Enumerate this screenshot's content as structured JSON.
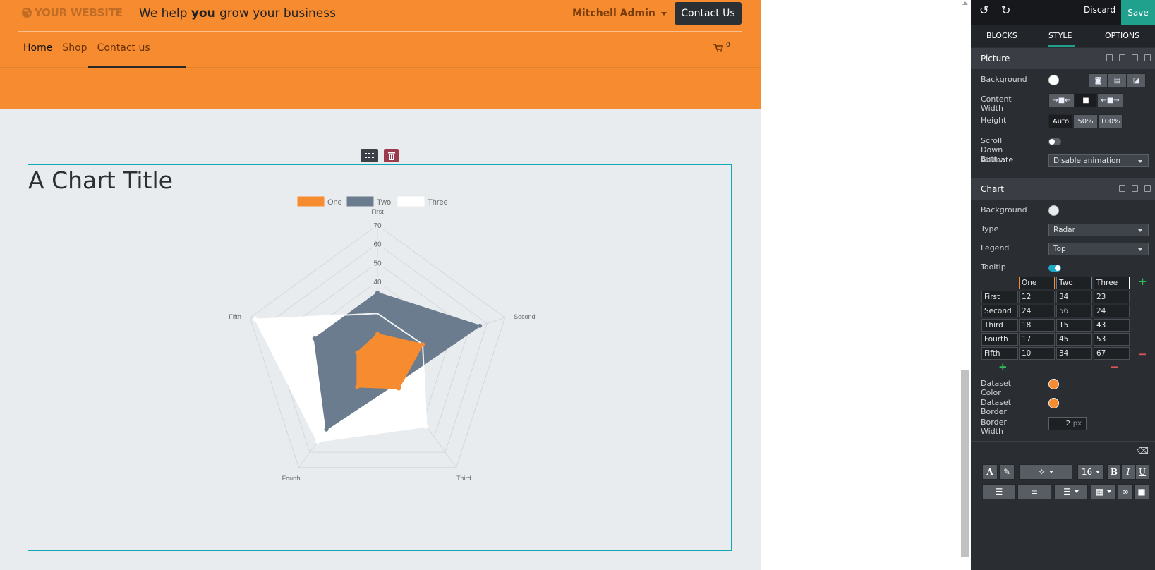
{
  "header": {
    "logo_text": "YOUR WEBSITE",
    "tagline_pre": "We help ",
    "tagline_bold": "you",
    "tagline_post": " grow your business",
    "user_name": "Mitchell Admin",
    "contact_label": "Contact Us",
    "cart_count": "0",
    "nav": [
      {
        "label": "Home",
        "active": true
      },
      {
        "label": "Shop",
        "active": false
      },
      {
        "label": "Contact us",
        "active": false
      }
    ]
  },
  "colors": {
    "brand_orange": "#f78b2f",
    "series_one": "#f78b2f",
    "series_two": "#6b7c8f",
    "series_three": "#ffffff",
    "accent_teal": "#1fa18e"
  },
  "chart_data": {
    "type": "radar",
    "title": "A Chart Title",
    "categories": [
      "First",
      "Second",
      "Third",
      "Fourth",
      "Fifth"
    ],
    "series": [
      {
        "name": "One",
        "values": [
          12,
          24,
          18,
          17,
          10
        ]
      },
      {
        "name": "Two",
        "values": [
          34,
          56,
          15,
          45,
          34
        ]
      },
      {
        "name": "Three",
        "values": [
          23,
          24,
          43,
          53,
          67
        ]
      }
    ],
    "r_ticks": [
      40,
      50,
      60,
      70
    ],
    "rlim": [
      10,
      70
    ],
    "legend": "top",
    "grid": true
  },
  "panel": {
    "discard_label": "Discard",
    "save_label": "Save",
    "tabs": [
      "BLOCKS",
      "STYLE",
      "OPTIONS"
    ],
    "picture": {
      "title": "Picture",
      "background_label": "Background",
      "content_width_label": "Content Width",
      "height_label": "Height",
      "height_options": [
        "Auto",
        "50%",
        "100%"
      ],
      "scroll_label": "Scroll Down Butt...",
      "animate_label": "Animate",
      "animate_value": "Disable animation"
    },
    "chart": {
      "title": "Chart",
      "background_label": "Background",
      "type_label": "Type",
      "type_value": "Radar",
      "legend_label": "Legend",
      "legend_value": "Top",
      "tooltip_label": "Tooltip",
      "dataset_color_label": "Dataset Color",
      "dataset_border_label": "Dataset Border",
      "border_width_label": "Border Width",
      "border_width_value": "2",
      "border_width_unit": "px",
      "table_headers": [
        "One",
        "Two",
        "Three"
      ],
      "table_rows": [
        {
          "label": "First",
          "values": [
            "12",
            "34",
            "23"
          ]
        },
        {
          "label": "Second",
          "values": [
            "24",
            "56",
            "24"
          ]
        },
        {
          "label": "Third",
          "values": [
            "18",
            "15",
            "43"
          ]
        },
        {
          "label": "Fourth",
          "values": [
            "17",
            "45",
            "53"
          ]
        },
        {
          "label": "Fifth",
          "values": [
            "10",
            "34",
            "67"
          ]
        }
      ]
    },
    "toolbar": {
      "font_size": "16",
      "bold": "B",
      "italic": "I",
      "underline": "U",
      "font_color": "A"
    },
    "icons": [
      "undo-icon",
      "redo-icon",
      "link-icon",
      "save-icon",
      "copy-icon",
      "trash-icon",
      "camera-icon",
      "film-icon",
      "image-icon",
      "eraser-icon",
      "brush-icon",
      "magic-icon",
      "list-icon",
      "numbered-list-icon",
      "align-icon",
      "table-icon",
      "cart-icon",
      "globe-icon",
      "grip-icon"
    ]
  }
}
